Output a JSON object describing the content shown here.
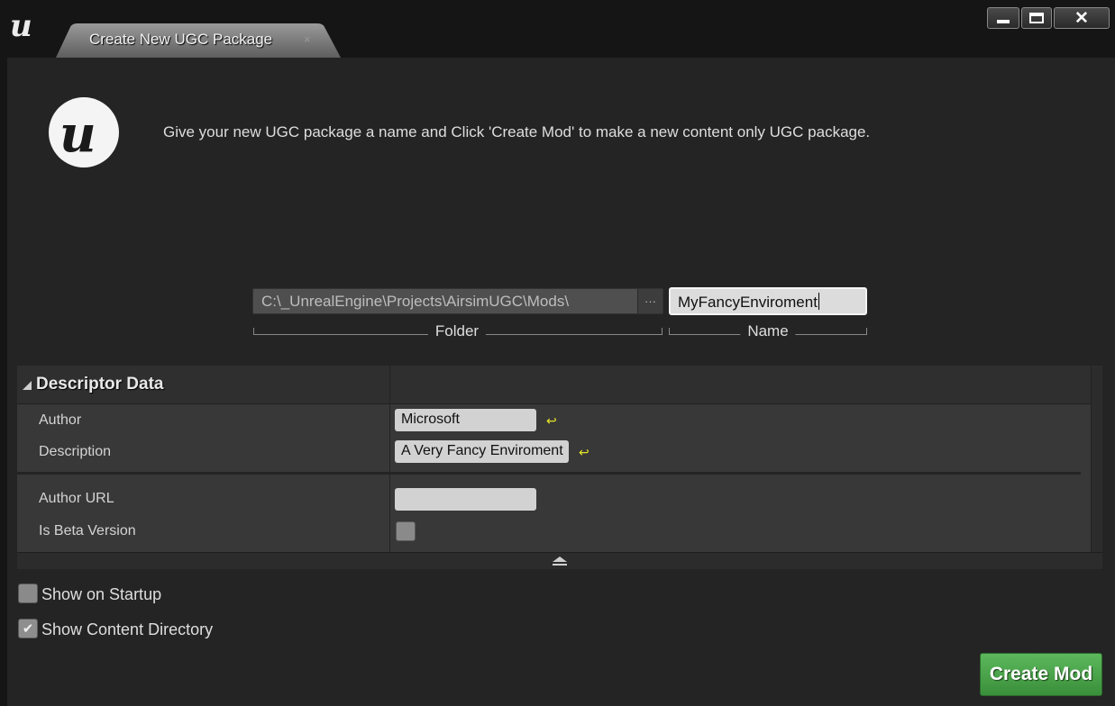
{
  "window": {
    "tab_title": "Create New UGC Package",
    "tab_close": "×",
    "close_glyph": "✕"
  },
  "intro_text": "Give your new UGC package a name and Click 'Create Mod' to make a new content only UGC package.",
  "folder": {
    "path": "C:\\_UnrealEngine\\Projects\\AirsimUGC\\Mods\\",
    "browse": "···",
    "label": "Folder"
  },
  "name": {
    "value": "MyFancyEnviroment",
    "label": "Name"
  },
  "descriptor": {
    "title": "Descriptor Data",
    "author_label": "Author",
    "author_value": "Microsoft",
    "description_label": "Description",
    "description_value": "A Very Fancy Enviroment",
    "author_url_label": "Author URL",
    "author_url_value": "",
    "beta_label": "Is Beta Version",
    "beta_checked": false,
    "reset_glyph": "↩"
  },
  "options": {
    "show_on_startup": "Show on Startup",
    "show_on_startup_checked": false,
    "show_content_directory": "Show Content Directory",
    "show_content_directory_checked": true,
    "check_glyph": "✔"
  },
  "create_button": "Create Mod",
  "colors": {
    "accent_green": "#4cae4c",
    "background": "#242424",
    "title_bar": "#151515",
    "reset_yellow": "#e5e52a"
  }
}
